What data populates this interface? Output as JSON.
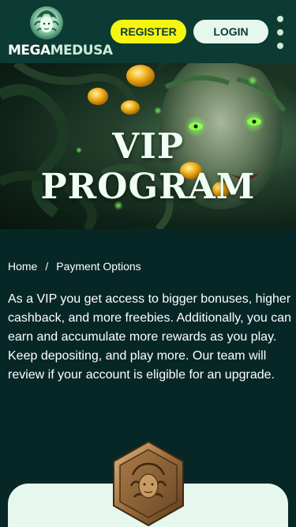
{
  "header": {
    "logo": {
      "mega": "MEGA",
      "medusa": "MEDUSA"
    },
    "register_label": "REGISTER",
    "login_label": "LOGIN",
    "menu_icon": "vertical-dots-icon"
  },
  "hero": {
    "title": "VIP PROGRAM"
  },
  "breadcrumb": {
    "home": "Home",
    "separator": "/",
    "current": "Payment Options"
  },
  "intro": {
    "text": "As a VIP you get access to bigger bonuses, higher cashback, and more freebies. Additionally, you can earn and accumulate more rewards as you play. Keep depositing, and play more. Our team will review if your account is eligible for an upgrade."
  },
  "colors": {
    "background": "#072727",
    "header": "#0b3b32",
    "register": "#f7f411",
    "login": "#e6f7ee",
    "card": "#e6f7ee"
  }
}
